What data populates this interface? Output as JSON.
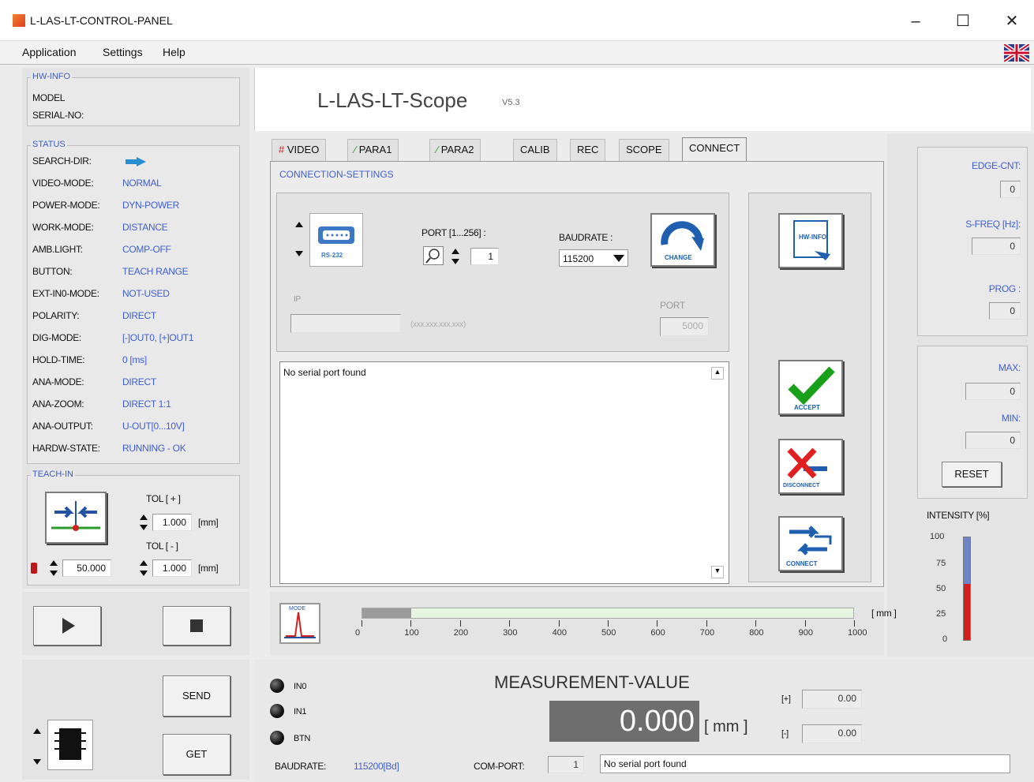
{
  "window": {
    "title": "L-LAS-LT-CONTROL-PANEL",
    "minimize": "–",
    "maximize": "☐",
    "close": "✕"
  },
  "menu": [
    "Application",
    "Settings",
    "Help"
  ],
  "app": {
    "name": "L-LAS-LT-Scope",
    "version": "V5.3"
  },
  "hwinfo": {
    "title": "HW-INFO",
    "model_label": "MODEL",
    "serial_label": "SERIAL-NO:"
  },
  "status": {
    "title": "STATUS",
    "rows": [
      {
        "label": "SEARCH-DIR:",
        "value": ""
      },
      {
        "label": "VIDEO-MODE:",
        "value": "NORMAL"
      },
      {
        "label": "POWER-MODE:",
        "value": "DYN-POWER"
      },
      {
        "label": "WORK-MODE:",
        "value": "DISTANCE"
      },
      {
        "label": "AMB.LIGHT:",
        "value": "COMP-OFF"
      },
      {
        "label": "BUTTON:",
        "value": "TEACH RANGE"
      },
      {
        "label": "EXT-IN0-MODE:",
        "value": "NOT-USED"
      },
      {
        "label": "POLARITY:",
        "value": "DIRECT"
      },
      {
        "label": "DIG-MODE:",
        "value": "[-]OUT0, [+]OUT1"
      },
      {
        "label": "HOLD-TIME:",
        "value": "0 [ms]"
      },
      {
        "label": "ANA-MODE:",
        "value": "DIRECT"
      },
      {
        "label": "ANA-ZOOM:",
        "value": "DIRECT 1:1"
      },
      {
        "label": "ANA-OUTPUT:",
        "value": "U-OUT[0...10V]"
      },
      {
        "label": "HARDW-STATE:",
        "value": "RUNNING - OK"
      }
    ]
  },
  "teach": {
    "title": "TEACH-IN",
    "tol_plus_label": "TOL [ + ]",
    "tol_plus": "1.000",
    "tol_minus_label": "TOL [ - ]",
    "tol_minus": "1.000",
    "unit": "[mm]",
    "value": "50.000"
  },
  "controls": {
    "send": "SEND",
    "get": "GET"
  },
  "tabs": [
    "VIDEO",
    "PARA1",
    "PARA2",
    "CALIB",
    "REC",
    "SCOPE",
    "CONNECT"
  ],
  "connection": {
    "title": "CONNECTION-SETTINGS",
    "port_label": "PORT [1...256] :",
    "port_value": "1",
    "baud_label": "BAUDRATE :",
    "baud_value": "115200",
    "ip_label": "IP",
    "ip_hint": "(xxx.xxx.xxx.xxx)",
    "ip_port_label": "PORT",
    "ip_port_value": "5000",
    "log": "No serial port found",
    "rs232": "RS-232",
    "change": "CHANGE"
  },
  "actions": {
    "hwinfo": "HW-INFO",
    "accept": "ACCEPT",
    "disconnect": "DISCONNECT",
    "connect": "CONNECT"
  },
  "right": {
    "edge_cnt_label": "EDGE-CNT:",
    "edge_cnt": "0",
    "sfreq_label": "S-FREQ [Hz]:",
    "sfreq": "0",
    "prog_label": "PROG :",
    "prog": "0",
    "max_label": "MAX:",
    "max": "0",
    "min_label": "MIN:",
    "min": "0",
    "reset": "RESET",
    "intensity_label": "INTENSITY [%]",
    "intensity_ticks": [
      "100",
      "75",
      "50",
      "25",
      "0"
    ],
    "intensity_value": 0.55
  },
  "scale": {
    "ticks": [
      "0",
      "100",
      "200",
      "300",
      "400",
      "500",
      "600",
      "700",
      "800",
      "900",
      "1000"
    ],
    "unit": "[ mm ]",
    "fill_value": 100,
    "mode": "MODE"
  },
  "measurement": {
    "title": "MEASUREMENT-VALUE",
    "value": "0.000",
    "unit": "[ mm ]",
    "plus_label": "[+]",
    "plus": "0.00",
    "minus_label": "[-]",
    "minus": "0.00"
  },
  "leds": [
    "IN0",
    "IN1",
    "BTN"
  ],
  "footer": {
    "baud_label": "BAUDRATE:",
    "baud_value": "115200[Bd]",
    "com_label": "COM-PORT:",
    "com_value": "1",
    "message": "No serial port found"
  },
  "colors": {
    "accent": "#3f5fd0",
    "bar_red": "#d61d1d",
    "bar_blue": "#6c85c8"
  }
}
